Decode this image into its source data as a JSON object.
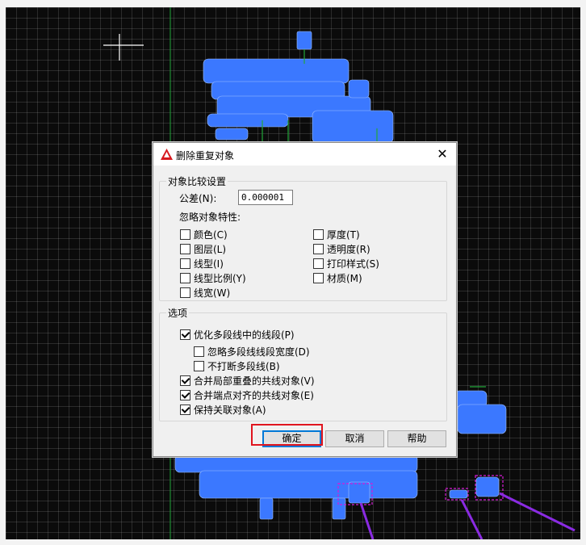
{
  "dialog": {
    "title": "删除重复对象",
    "close_glyph": "✕",
    "compare_group": {
      "label": "对象比较设置",
      "tolerance_label": "公差(N):",
      "tolerance_value": "0.000001",
      "ignore_label": "忽略对象特性:",
      "properties_left": [
        {
          "label": "颜色(C)",
          "checked": false
        },
        {
          "label": "图层(L)",
          "checked": false
        },
        {
          "label": "线型(I)",
          "checked": false
        },
        {
          "label": "线型比例(Y)",
          "checked": false
        },
        {
          "label": "线宽(W)",
          "checked": false
        }
      ],
      "properties_right": [
        {
          "label": "厚度(T)",
          "checked": false
        },
        {
          "label": "透明度(R)",
          "checked": false
        },
        {
          "label": "打印样式(S)",
          "checked": false
        },
        {
          "label": "材质(M)",
          "checked": false
        }
      ]
    },
    "options_group": {
      "label": "选项",
      "optimize": {
        "label": "优化多段线中的线段(P)",
        "checked": true
      },
      "ignore_width": {
        "label": "忽略多段线线段宽度(D)",
        "checked": false
      },
      "no_break": {
        "label": "不打断多段线(B)",
        "checked": false
      },
      "merge_overlap": {
        "label": "合并局部重叠的共线对象(V)",
        "checked": true
      },
      "merge_endpoint": {
        "label": "合并端点对齐的共线对象(E)",
        "checked": true
      },
      "keep_assoc": {
        "label": "保持关联对象(A)",
        "checked": true
      }
    },
    "buttons": {
      "ok": "确定",
      "cancel": "取消",
      "help": "帮助"
    }
  },
  "colors": {
    "canvas_bg": "#0b0b0b",
    "cad_blue": "#3b78ff",
    "cad_magenta": "#d61ad6",
    "cad_violet": "#8a2be2",
    "cad_green": "#22a63a",
    "highlight_red": "#e0141e"
  }
}
